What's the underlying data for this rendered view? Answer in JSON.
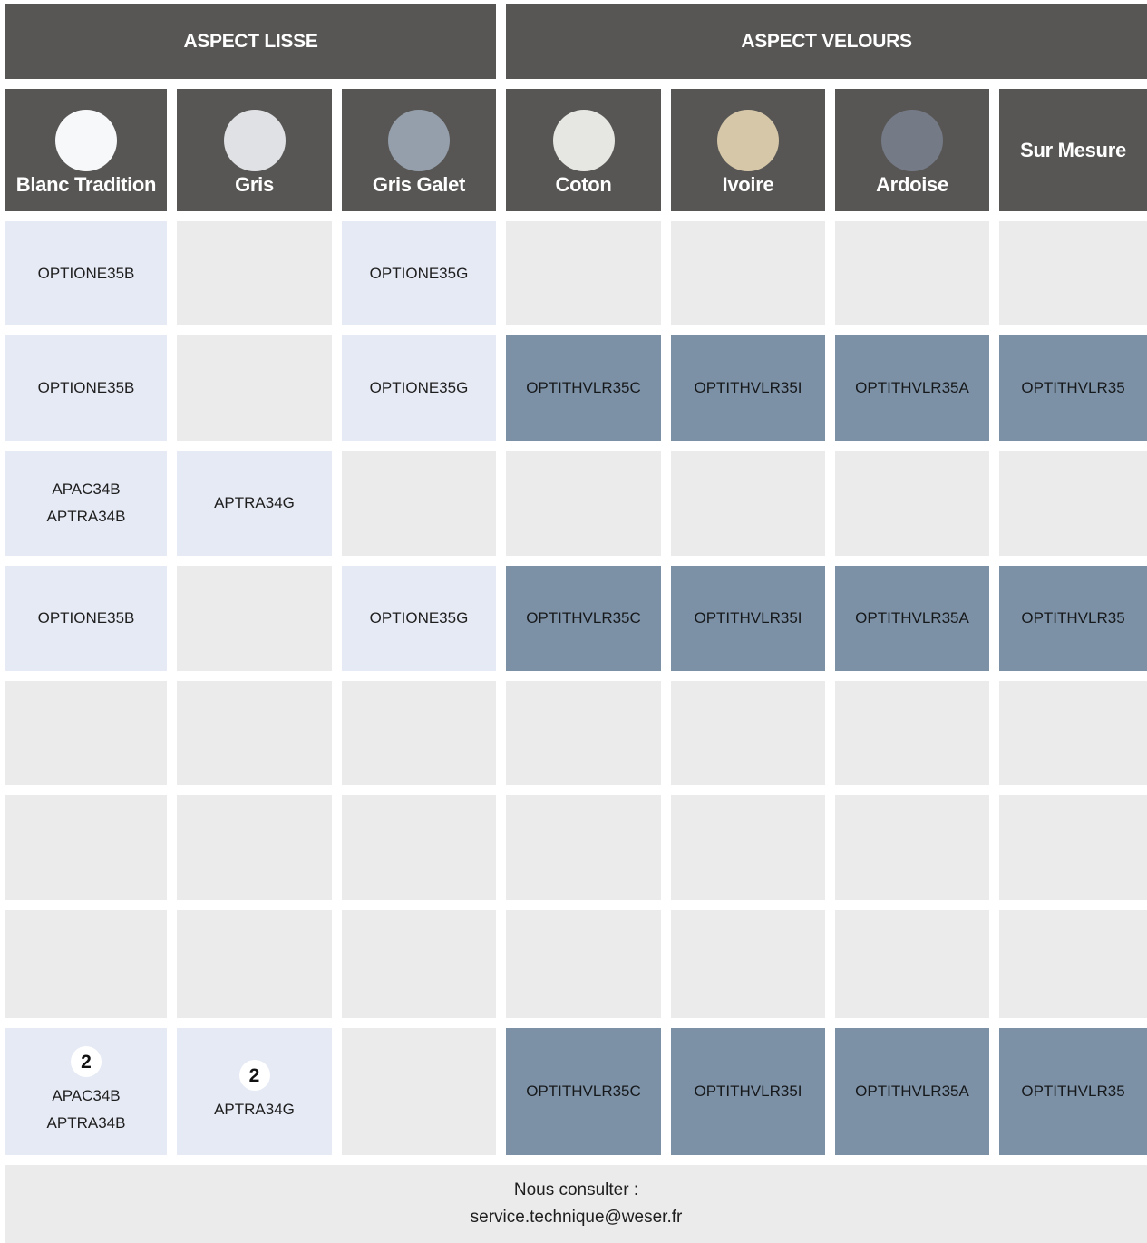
{
  "groups": {
    "smooth": "ASPECT LISSE",
    "velvet": "ASPECT VELOURS"
  },
  "columns": [
    {
      "label": "Blanc Tradition",
      "swatch": "#f7f8fa",
      "swatch_name": "white-swatch"
    },
    {
      "label": "Gris",
      "swatch": "#dfe1e4",
      "swatch_name": "light-grey-swatch"
    },
    {
      "label": "Gris Galet",
      "swatch": "#959fab",
      "swatch_name": "pebble-grey-swatch"
    },
    {
      "label": "Coton",
      "swatch": "#e6e6e3",
      "swatch_name": "cotton-swatch"
    },
    {
      "label": "Ivoire",
      "swatch": "#d6c7a8",
      "swatch_name": "ivory-swatch"
    },
    {
      "label": "Ardoise",
      "swatch": "#757a87",
      "swatch_name": "slate-swatch"
    },
    {
      "label": "Sur Mesure",
      "swatch": null,
      "swatch_name": null
    }
  ],
  "colors": {
    "header_bg": "#575654",
    "smooth_cell": "#e6eaf5",
    "velvet_cell": "#7d91a6",
    "empty_cell": "#ebebeb"
  },
  "rows": [
    [
      {
        "type": "smooth",
        "lines": [
          "OPTIONE35B"
        ]
      },
      {
        "type": "empty",
        "lines": []
      },
      {
        "type": "smooth",
        "lines": [
          "OPTIONE35G"
        ]
      },
      {
        "type": "empty",
        "lines": []
      },
      {
        "type": "empty",
        "lines": []
      },
      {
        "type": "empty",
        "lines": []
      },
      {
        "type": "empty",
        "lines": []
      }
    ],
    [
      {
        "type": "smooth",
        "lines": [
          "OPTIONE35B"
        ]
      },
      {
        "type": "empty",
        "lines": []
      },
      {
        "type": "smooth",
        "lines": [
          "OPTIONE35G"
        ]
      },
      {
        "type": "velvet",
        "lines": [
          "OPTITHVLR35C"
        ]
      },
      {
        "type": "velvet",
        "lines": [
          "OPTITHVLR35I"
        ]
      },
      {
        "type": "velvet",
        "lines": [
          "OPTITHVLR35A"
        ]
      },
      {
        "type": "velvet",
        "lines": [
          "OPTITHVLR35"
        ]
      }
    ],
    [
      {
        "type": "smooth",
        "lines": [
          "APAC34B",
          "APTRA34B"
        ]
      },
      {
        "type": "smooth",
        "lines": [
          "APTRA34G"
        ]
      },
      {
        "type": "empty",
        "lines": []
      },
      {
        "type": "empty",
        "lines": []
      },
      {
        "type": "empty",
        "lines": []
      },
      {
        "type": "empty",
        "lines": []
      },
      {
        "type": "empty",
        "lines": []
      }
    ],
    [
      {
        "type": "smooth",
        "lines": [
          "OPTIONE35B"
        ]
      },
      {
        "type": "empty",
        "lines": []
      },
      {
        "type": "smooth",
        "lines": [
          "OPTIONE35G"
        ]
      },
      {
        "type": "velvet",
        "lines": [
          "OPTITHVLR35C"
        ]
      },
      {
        "type": "velvet",
        "lines": [
          "OPTITHVLR35I"
        ]
      },
      {
        "type": "velvet",
        "lines": [
          "OPTITHVLR35A"
        ]
      },
      {
        "type": "velvet",
        "lines": [
          "OPTITHVLR35"
        ]
      }
    ],
    [
      {
        "type": "empty",
        "lines": []
      },
      {
        "type": "empty",
        "lines": []
      },
      {
        "type": "empty",
        "lines": []
      },
      {
        "type": "empty",
        "lines": []
      },
      {
        "type": "empty",
        "lines": []
      },
      {
        "type": "empty",
        "lines": []
      },
      {
        "type": "empty",
        "lines": []
      }
    ],
    [
      {
        "type": "empty",
        "lines": []
      },
      {
        "type": "empty",
        "lines": []
      },
      {
        "type": "empty",
        "lines": []
      },
      {
        "type": "empty",
        "lines": []
      },
      {
        "type": "empty",
        "lines": []
      },
      {
        "type": "empty",
        "lines": []
      },
      {
        "type": "empty",
        "lines": []
      }
    ],
    [
      {
        "type": "empty",
        "lines": []
      },
      {
        "type": "empty",
        "lines": []
      },
      {
        "type": "empty",
        "lines": []
      },
      {
        "type": "empty",
        "lines": []
      },
      {
        "type": "empty",
        "lines": []
      },
      {
        "type": "empty",
        "lines": []
      },
      {
        "type": "empty",
        "lines": []
      }
    ],
    [
      {
        "type": "smooth",
        "badge": "2",
        "lines": [
          "APAC34B",
          "APTRA34B"
        ]
      },
      {
        "type": "smooth",
        "badge": "2",
        "lines": [
          "APTRA34G"
        ]
      },
      {
        "type": "empty",
        "lines": []
      },
      {
        "type": "velvet",
        "lines": [
          "OPTITHVLR35C"
        ]
      },
      {
        "type": "velvet",
        "lines": [
          "OPTITHVLR35I"
        ]
      },
      {
        "type": "velvet",
        "lines": [
          "OPTITHVLR35A"
        ]
      },
      {
        "type": "velvet",
        "lines": [
          "OPTITHVLR35"
        ]
      }
    ]
  ],
  "footer": {
    "line1": "Nous consulter :",
    "line2": "service.technique@weser.fr"
  }
}
